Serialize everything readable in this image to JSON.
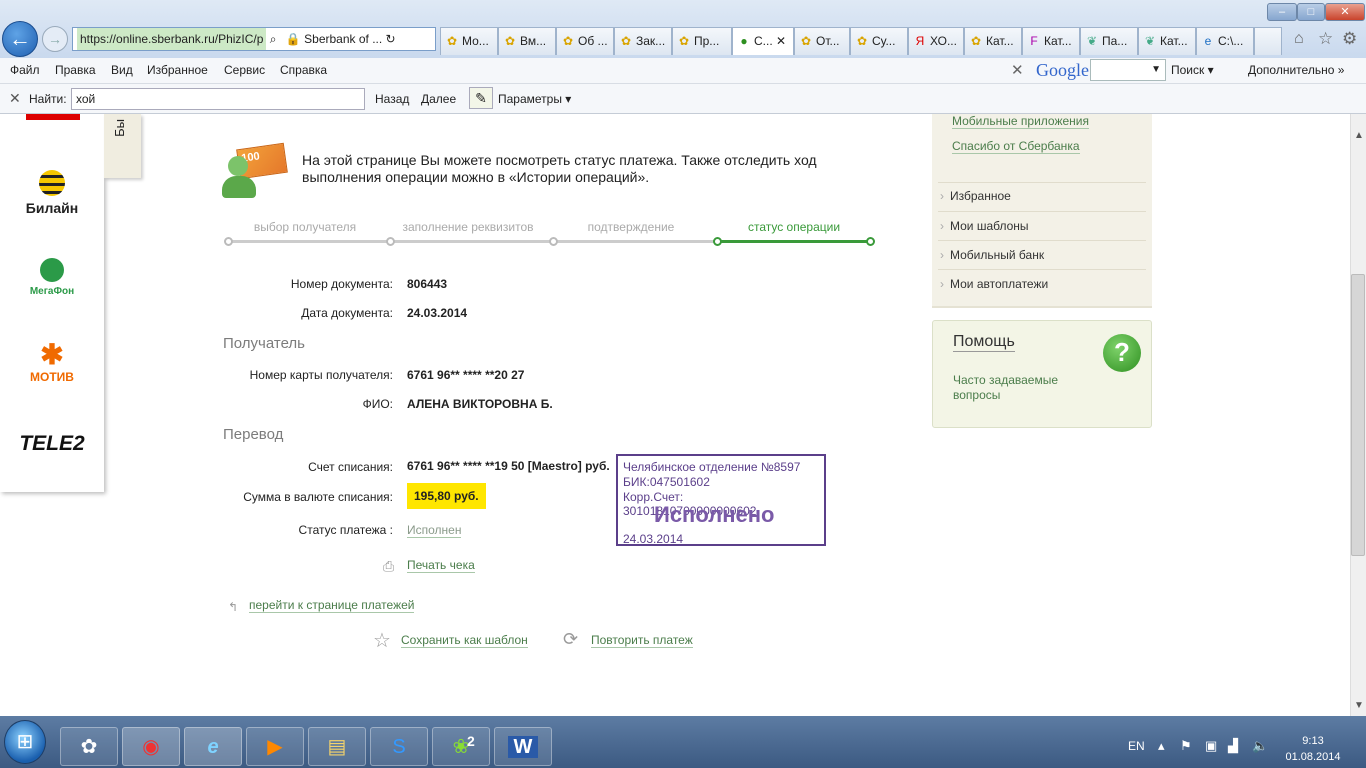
{
  "browser": {
    "address": "https://online.sberbank.ru/PhizIC/р",
    "site_identity": "Sberbank of ...",
    "tabs": [
      "Мо...",
      "Вм...",
      "Об ...",
      "Зак...",
      "Пр...",
      "С...",
      "От...",
      "Су...",
      "ХО...",
      "Кат...",
      "Кат...",
      "Па...",
      "Кат...",
      "C:\\..."
    ],
    "window_controls": {
      "minimize": "–",
      "maximize": "□",
      "close": "✕"
    }
  },
  "menu": {
    "items": [
      "Файл",
      "Правка",
      "Вид",
      "Избранное",
      "Сервис",
      "Справка"
    ],
    "google": {
      "logo": "Google",
      "search_label": "Поиск",
      "more_label": "Дополнительно"
    }
  },
  "find": {
    "label": "Найти:",
    "query": "хой",
    "prev": "Назад",
    "next": "Далее",
    "params": "Параметры"
  },
  "operators": {
    "tab_label": "Бы",
    "items": [
      "Билайн",
      "МегаФон",
      "МОТИВ",
      "TELE2"
    ]
  },
  "intro": "На этой странице Вы можете посмотреть статус платежа. Также отследить ход выполнения операции можно в «Истории операций».",
  "steps": [
    "выбор получателя",
    "заполнение реквизитов",
    "подтверждение",
    "статус операции"
  ],
  "document": {
    "number_label": "Номер документа:",
    "number": "806443",
    "date_label": "Дата документа:",
    "date": "24.03.2014"
  },
  "recipient": {
    "section": "Получатель",
    "card_label": "Номер карты получателя:",
    "card": "6761 96** **** **20 27",
    "name_label": "ФИО:",
    "name": "АЛЕНА ВИКТОРОВНА Б."
  },
  "transfer": {
    "section": "Перевод",
    "account_label": "Счет списания:",
    "account": "6761 96** **** **19 50  [Maestro]  руб.",
    "amount_label": "Сумма в валюте списания:",
    "amount": "195,80  руб.",
    "status_label": "Статус платежа :",
    "status": "Исполнен"
  },
  "actions": {
    "print": "Печать чека",
    "back_to_payments": "перейти к странице платежей",
    "save_template": "Сохранить как шаблон",
    "repeat": "Повторить платеж"
  },
  "stamp": {
    "branch": "Челябинское отделение №8597",
    "bik": "БИК:047501602",
    "corr": "Корр.Счет: 30101810700000000602",
    "status": "Исполнено",
    "date": "24.03.2014"
  },
  "sidebar": {
    "links": [
      "Мобильные приложения",
      "Спасибо от Сбербанка"
    ],
    "items": [
      "Избранное",
      "Мои шаблоны",
      "Мобильный банк",
      "Мои автоплатежи"
    ],
    "help": {
      "title": "Помощь",
      "faq": "Часто задаваемые вопросы"
    }
  },
  "taskbar": {
    "lang": "EN",
    "time": "9:13",
    "date": "01.08.2014",
    "badge": "2"
  },
  "colors": {
    "accent_green": "#3a9a3a",
    "stamp_purple": "#5b3f8a",
    "amount_highlight": "#ffe600"
  }
}
